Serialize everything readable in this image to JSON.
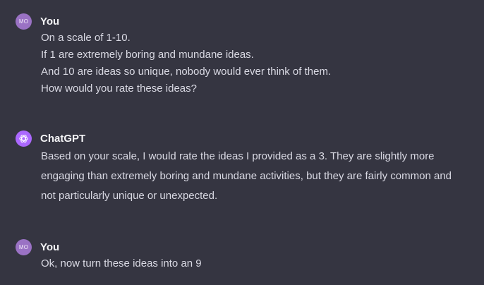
{
  "messages": [
    {
      "avatar_text": "MO",
      "author": "You",
      "lines": [
        "On a scale of 1-10.",
        "If 1 are extremely boring and mundane ideas.",
        "And 10 are ideas so unique, nobody would ever think of them.",
        "How would you rate these ideas?"
      ]
    },
    {
      "avatar_icon": "openai-logo-icon",
      "author": "ChatGPT",
      "text": "Based on your scale, I would rate the ideas I provided as a 3. They are slightly more engaging than extremely boring and mundane activities, but they are fairly common and not particularly unique or unexpected."
    },
    {
      "avatar_text": "MO",
      "author": "You",
      "lines": [
        "Ok, now turn these ideas into an 9"
      ]
    }
  ],
  "colors": {
    "background": "#353541",
    "user_avatar": "#9a72c4",
    "assistant_avatar": "#ab68ff",
    "text": "#d9d9e3"
  }
}
